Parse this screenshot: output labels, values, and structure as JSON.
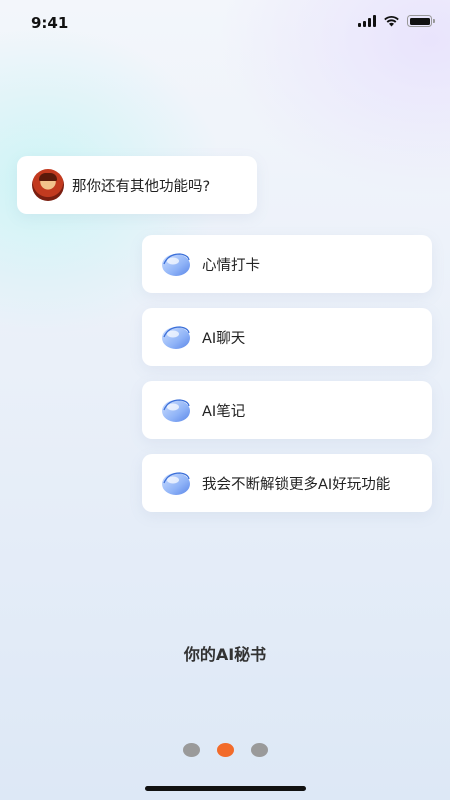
{
  "status_bar": {
    "time": "9:41"
  },
  "chat": {
    "user_message": "那你还有其他功能吗?",
    "replies": [
      "心情打卡",
      "AI聊天",
      "AI笔记",
      "我会不断解锁更多AI好玩功能"
    ]
  },
  "caption": "你的AI秘书",
  "pagination": {
    "total": 3,
    "current": 2
  },
  "colors": {
    "active_dot": "#f26b2a",
    "inactive_dot": "#9a9a9a"
  },
  "icons": {
    "ai_bot": "ai-orb-icon",
    "user_avatar": "avatar"
  }
}
